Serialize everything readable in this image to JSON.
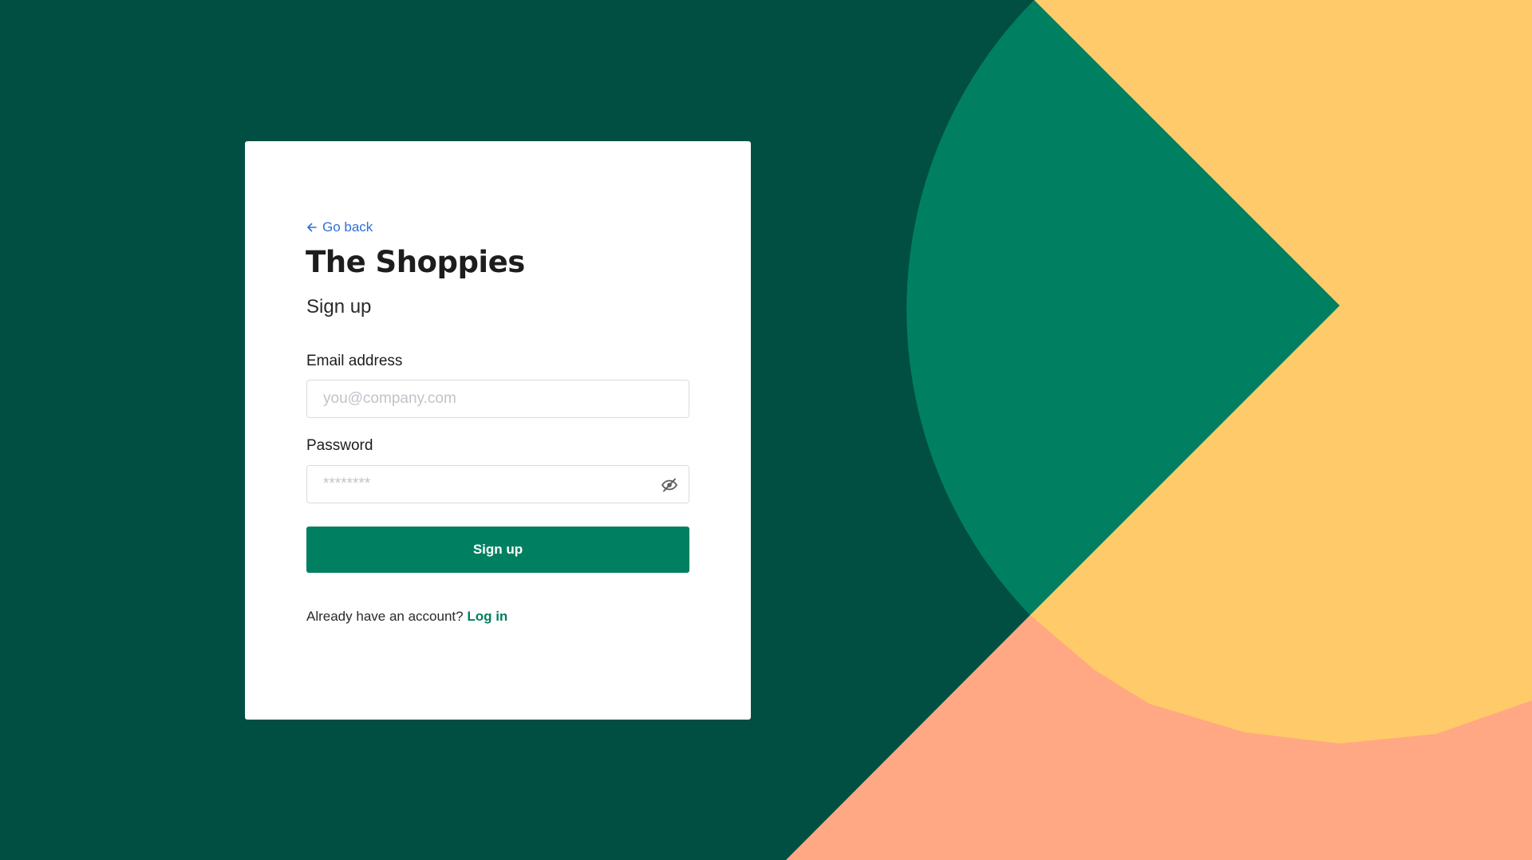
{
  "colors": {
    "background_dark": "#004f42",
    "shape_green": "#008060",
    "shape_yellow": "#ffca69",
    "shape_salmon": "#ffa883",
    "card": "#ffffff",
    "primary": "#008060",
    "link": "#2f6fd6"
  },
  "nav": {
    "back_label": "Go back",
    "back_icon": "arrow-left-icon"
  },
  "brand": {
    "title": "The Shoppies"
  },
  "form": {
    "subtitle": "Sign up",
    "email": {
      "label": "Email address",
      "placeholder": "you@company.com",
      "value": ""
    },
    "password": {
      "label": "Password",
      "placeholder": "********",
      "value": "",
      "toggle_icon": "eye-off-icon"
    },
    "submit_label": "Sign up"
  },
  "footer": {
    "prompt": "Already have an account?",
    "login_label": "Log in"
  }
}
